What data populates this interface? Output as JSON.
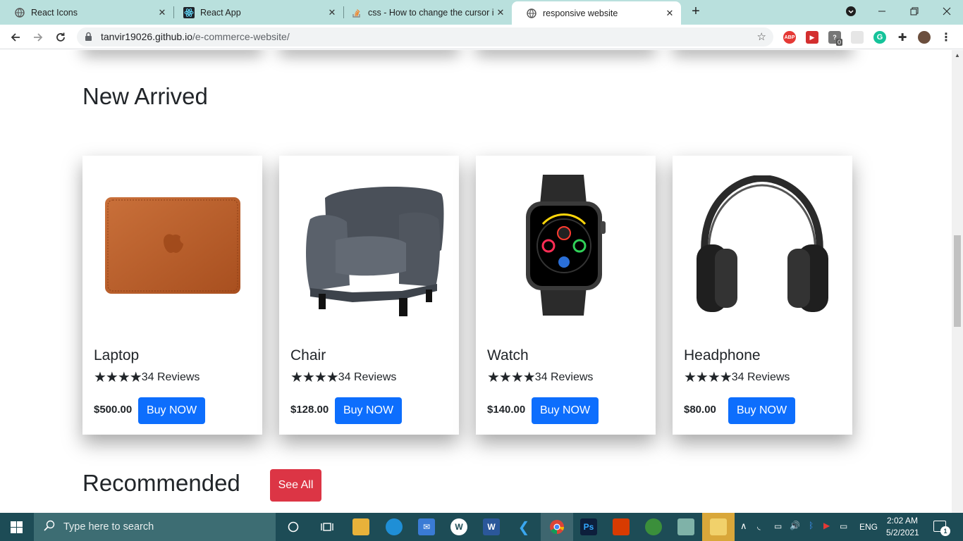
{
  "browser": {
    "tabs": [
      {
        "title": "React Icons",
        "icon": "globe-icon"
      },
      {
        "title": "React App",
        "icon": "react-icon"
      },
      {
        "title": "css - How to change the cursor in",
        "icon": "stackoverflow-icon"
      },
      {
        "title": "responsive website",
        "icon": "globe-icon",
        "active": true
      }
    ],
    "url_host": "tanvir19026.github.io",
    "url_path": "/e-commerce-website/",
    "ext_badge": "0"
  },
  "new_arrived": {
    "title": "New Arrived",
    "products": [
      {
        "name": "Laptop",
        "stars": "★★★★",
        "rating": 4,
        "reviews": "34 Reviews",
        "price": "$500.00",
        "buy_label": "Buy NOW",
        "image": "laptop-sleeve-image"
      },
      {
        "name": "Chair",
        "stars": "★★★★",
        "rating": 4,
        "reviews": "34 Reviews",
        "price": "$128.00",
        "buy_label": "Buy NOW",
        "image": "armchair-image"
      },
      {
        "name": "Watch",
        "stars": "★★★★",
        "rating": 4,
        "reviews": "34 Reviews",
        "price": "$140.00",
        "buy_label": "Buy NOW",
        "image": "smartwatch-image"
      },
      {
        "name": "Headphone",
        "stars": "★★★★",
        "rating": 4,
        "reviews": "34 Reviews",
        "price": "$80.00",
        "buy_label": "Buy NOW",
        "image": "headphone-image"
      }
    ]
  },
  "recommended": {
    "title": "Recommended",
    "see_all_label": "See All"
  },
  "taskbar": {
    "search_placeholder": "Type here to search",
    "language": "ENG",
    "time": "2:02 AM",
    "date": "5/2/2021",
    "notification_count": "1"
  },
  "colors": {
    "primary_button": "#0d6efd",
    "danger_button": "#dc3545",
    "tab_strip": "#b9e0dd",
    "taskbar": "#1d4c56"
  }
}
